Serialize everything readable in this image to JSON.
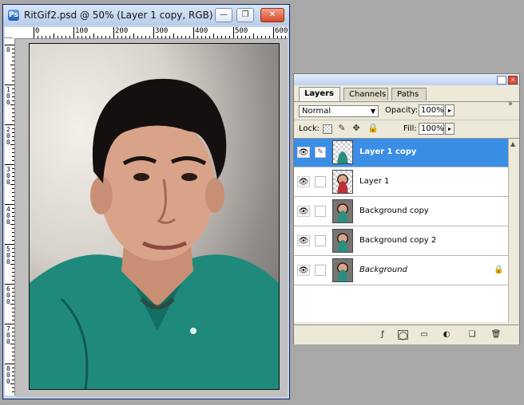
{
  "document": {
    "title": "RitGif2.psd @ 50% (Layer 1 copy, RGB)",
    "ruler_h_labels": [
      "0",
      "100",
      "200",
      "300",
      "400",
      "500",
      "600"
    ],
    "ruler_v_labels": [
      "0",
      "100",
      "200",
      "300",
      "400",
      "500",
      "600",
      "700",
      "800"
    ],
    "controls": {
      "minimize": "—",
      "maximize": "❐",
      "close": "✕"
    }
  },
  "layers_panel": {
    "tabs": [
      "Layers",
      "Channels",
      "Paths"
    ],
    "active_tab": "Layers",
    "menu_glyph": "»",
    "blend_mode": "Normal",
    "opacity_label": "Opacity:",
    "opacity_value": "100%",
    "lock_label": "Lock:",
    "fill_label": "Fill:",
    "fill_value": "100%",
    "layers": [
      {
        "name": "Layer 1 copy",
        "selected": true,
        "visible": true,
        "thumb": "teal"
      },
      {
        "name": "Layer 1",
        "selected": false,
        "visible": true,
        "thumb": "red"
      },
      {
        "name": "Background copy",
        "selected": false,
        "visible": true,
        "thumb": "bg"
      },
      {
        "name": "Background copy 2",
        "selected": false,
        "visible": true,
        "thumb": "bg"
      },
      {
        "name": "Background",
        "selected": false,
        "visible": true,
        "thumb": "bg",
        "locked": true
      }
    ],
    "colors": {
      "selected_row": "#3a8ee6",
      "panel": "#ece9d8"
    }
  }
}
